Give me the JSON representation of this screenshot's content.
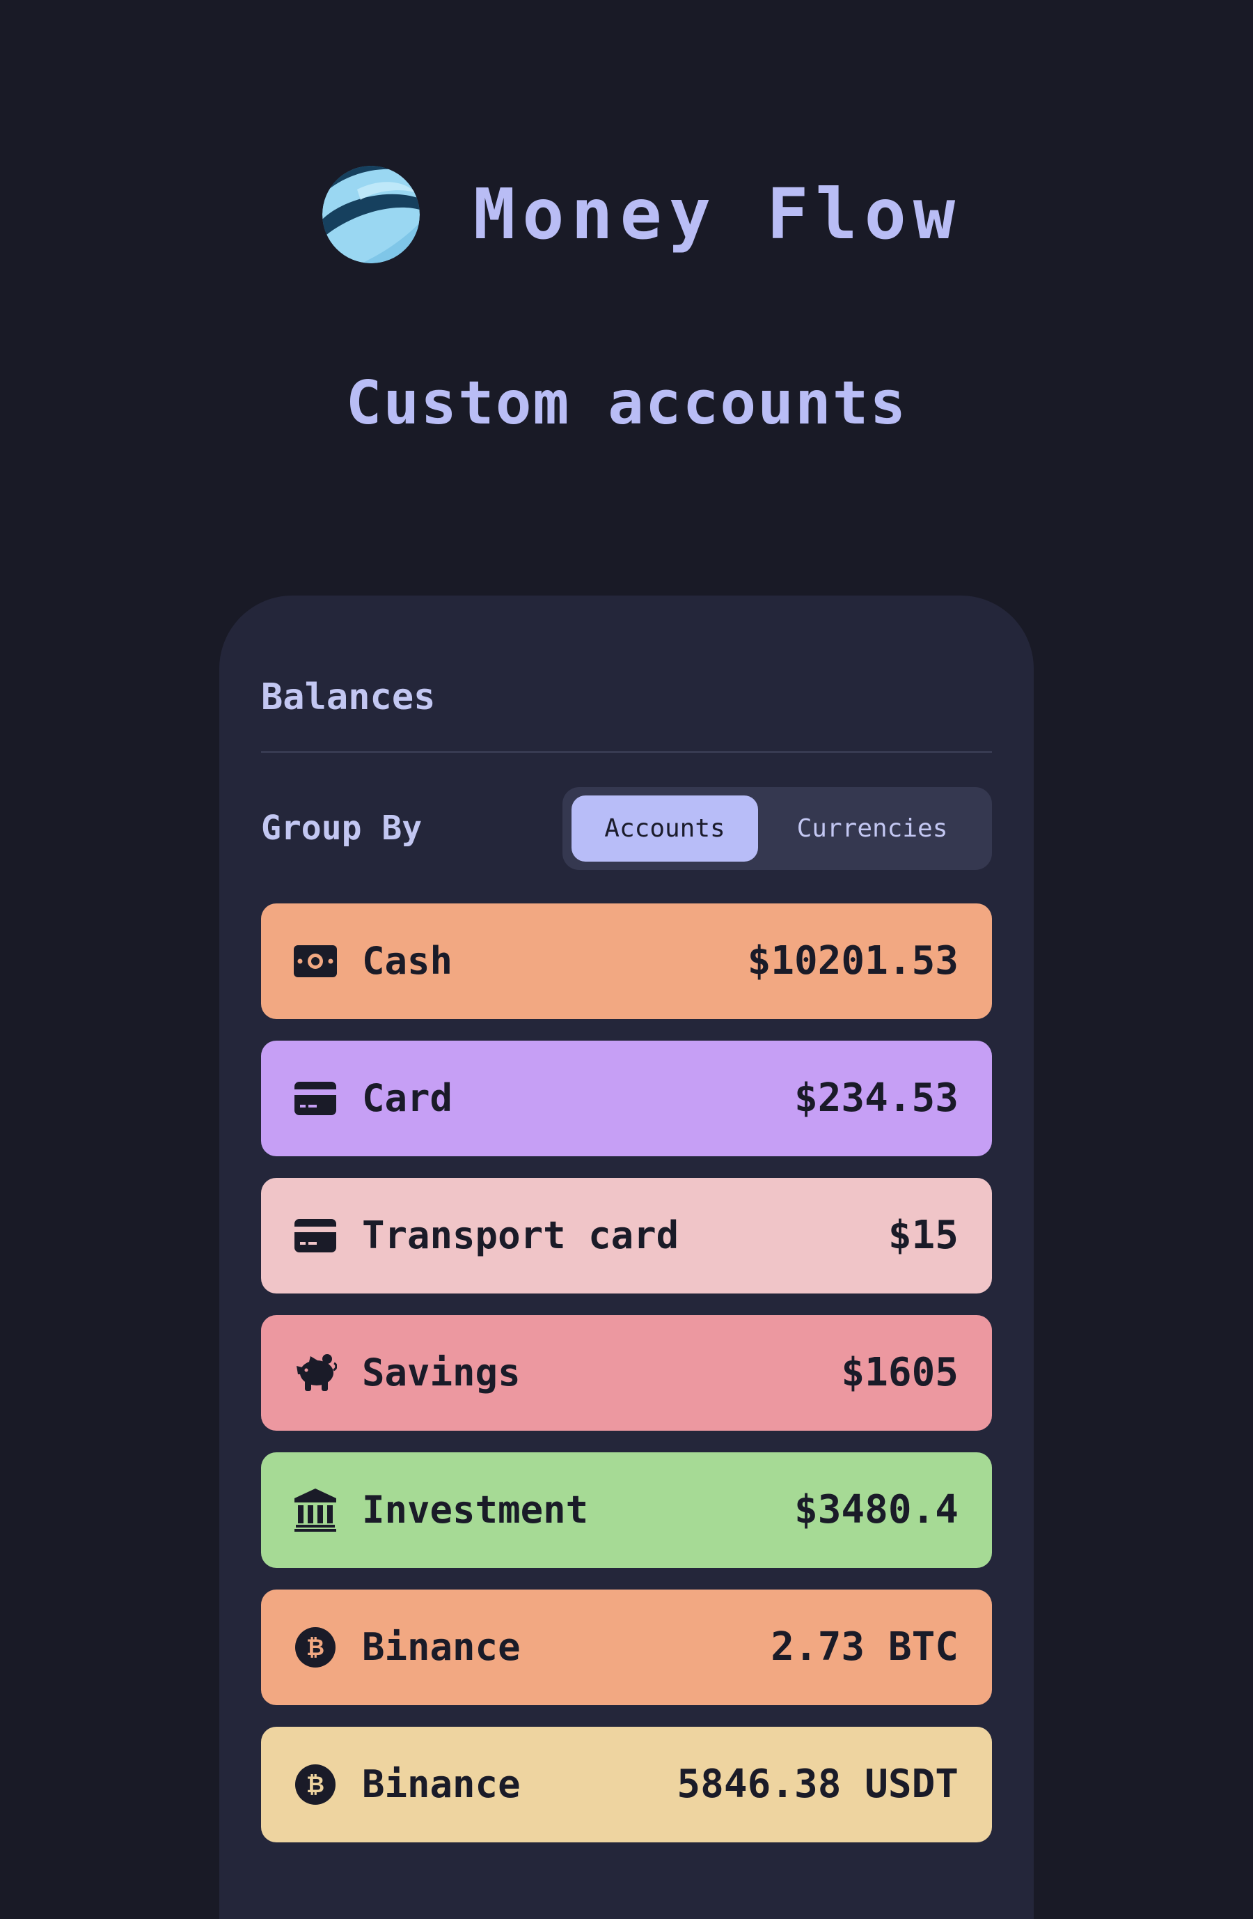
{
  "brand": {
    "name": "Money Flow",
    "logo_icon": "money-flow-logo",
    "logo_colors": [
      "#16405e",
      "#9ad7f2"
    ]
  },
  "tagline": "Custom accounts",
  "panel": {
    "title": "Balances",
    "group_by": {
      "label": "Group By",
      "options": [
        {
          "label": "Accounts",
          "selected": true
        },
        {
          "label": "Currencies",
          "selected": false
        }
      ]
    },
    "accounts": [
      {
        "name": "Cash",
        "amount": "$10201.53",
        "icon": "banknote-icon",
        "color": "#f2a882"
      },
      {
        "name": "Card",
        "amount": "$234.53",
        "icon": "credit-card-icon",
        "color": "#c69ff5"
      },
      {
        "name": "Transport card",
        "amount": "$15",
        "icon": "credit-card-icon",
        "color": "#f0c5c8"
      },
      {
        "name": "Savings",
        "amount": "$1605",
        "icon": "piggy-bank-icon",
        "color": "#ec98a0"
      },
      {
        "name": "Investment",
        "amount": "$3480.4",
        "icon": "bank-icon",
        "color": "#a6da95"
      },
      {
        "name": "Binance",
        "amount": "2.73 BTC",
        "icon": "bitcoin-icon",
        "color": "#f2a882"
      },
      {
        "name": "Binance",
        "amount": "5846.38 USDT",
        "icon": "bitcoin-icon",
        "color": "#eed4a0"
      }
    ]
  },
  "colors": {
    "background": "#191a26",
    "panel": "#24263a",
    "accent": "#b8bdf8",
    "row_text": "#1a1b28"
  }
}
